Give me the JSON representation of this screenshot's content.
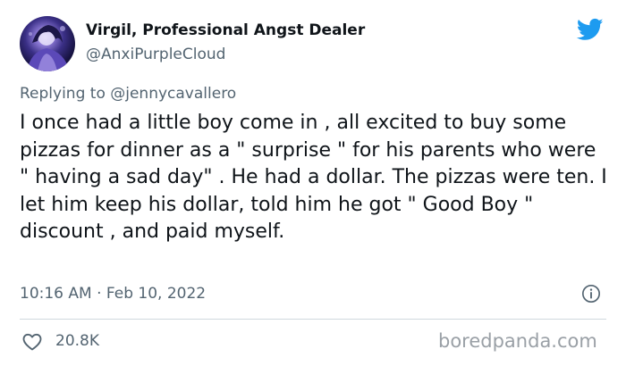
{
  "author": {
    "display_name": "Virgil, Professional Angst Dealer",
    "handle": "@AnxiPurpleCloud",
    "avatar": "avatar-image"
  },
  "reply": {
    "prefix": "Replying to",
    "mention": "@jennycavallero"
  },
  "tweet": {
    "text": "I once had a little boy come in , all excited to buy some pizzas for dinner as a \" surprise \" for his parents who were \" having a sad day\" . He had a dollar. The pizzas were ten. I let him keep his dollar, told him he got \" Good Boy \" discount , and paid myself.",
    "timestamp": "10:16 AM · Feb 10, 2022"
  },
  "stats": {
    "likes": "20.8K"
  },
  "icons": {
    "brand": "twitter-bird-icon",
    "info": "info-icon",
    "like": "heart-icon"
  },
  "watermark": "boredpanda.com",
  "colors": {
    "twitter_blue": "#1d9bf0",
    "text_primary": "#0f1419",
    "text_secondary": "#536471",
    "divider": "#cfd9de"
  }
}
